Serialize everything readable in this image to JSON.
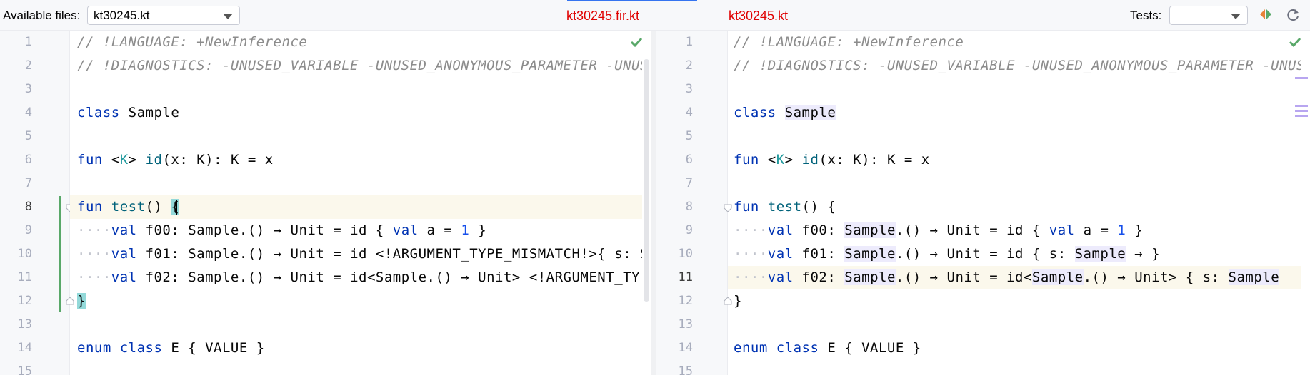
{
  "toolbar": {
    "available_files_label": "Available files:",
    "file_selected": "kt30245.kt",
    "left_title": "kt30245.fir.kt",
    "right_title": "kt30245.kt",
    "tests_label": "Tests:",
    "tests_selected": ""
  },
  "colors": {
    "title_red": "#e00000",
    "keyword": "#0033b3",
    "function": "#00627a",
    "comment": "#8c8c8c",
    "number": "#1750eb",
    "check_green": "#59a869"
  },
  "left_pane": {
    "line_numbers": [
      "1",
      "2",
      "3",
      "4",
      "5",
      "6",
      "7",
      "8",
      "9",
      "10",
      "11",
      "12",
      "13",
      "14",
      "15"
    ],
    "lines": {
      "l1": "// !LANGUAGE: +NewInference",
      "l2": "// !DIAGNOSTICS: -UNUSED_VARIABLE -UNUSED_ANONYMOUS_PARAMETER -UNUSE",
      "l4a": "class",
      "l4b": "Sample",
      "l6a": "fun",
      "l6b": "K",
      "l6c": "id",
      "l6d": "(x: K): K = x",
      "l8a": "fun",
      "l8b": "test",
      "l8c": "() ",
      "l8d": "{",
      "indent": "····",
      "l9a": "val",
      "l9b": "f00: Sample.() → Unit = id { ",
      "l9c": "val",
      "l9d": " a = ",
      "l9e": "1",
      "l9f": " }",
      "l10a": "val",
      "l10b": "f01: Sample.() → Unit = id <!ARGUMENT_TYPE_MISMATCH!>{ s: S",
      "l11a": "val",
      "l11b": "f02: Sample.() → Unit = id<Sample.() → Unit> <!ARGUMENT_TY",
      "l12": "}",
      "l14a": "enum class",
      "l14b": "E { VALUE }"
    }
  },
  "right_pane": {
    "line_numbers": [
      "1",
      "2",
      "3",
      "4",
      "5",
      "6",
      "7",
      "8",
      "9",
      "10",
      "11",
      "12",
      "13",
      "14",
      "15"
    ],
    "lines": {
      "l1": "// !LANGUAGE: +NewInference",
      "l2": "// !DIAGNOSTICS: -UNUSED_VARIABLE -UNUSED_ANONYMOUS_PARAMETER -UNUS",
      "l4a": "class",
      "l4b": "Sample",
      "l6a": "fun",
      "l6b": "K",
      "l6c": "id",
      "l6d": "(x: K): K = x",
      "l8a": "fun",
      "l8b": "test",
      "l8c": "() {",
      "indent": "····",
      "l9a": "val",
      "l9b": "f00: ",
      "l9c": "Sample",
      "l9d": ".() → Unit = id { ",
      "l9e": "val",
      "l9f": " a = ",
      "l9g": "1",
      "l9h": " }",
      "l10a": "val",
      "l10b": "f01: ",
      "l10c": "Sample",
      "l10d": ".() → Unit = id { s: ",
      "l10e": "Sample",
      "l10f": " → }",
      "l11a": "val",
      "l11b": "f02: ",
      "l11c": "Sample",
      "l11d": ".() → Unit = id<",
      "l11e": "Sample",
      "l11f": ".() → Unit> { s: ",
      "l11g": "Sample",
      "l12": "}",
      "l14a": "enum class",
      "l14b": "E { VALUE }"
    }
  },
  "icons": {
    "check": "check-icon",
    "compare": "compare-arrows-icon",
    "refresh": "refresh-icon",
    "fold": "fold-icon",
    "dropdown": "chevron-down-icon"
  }
}
